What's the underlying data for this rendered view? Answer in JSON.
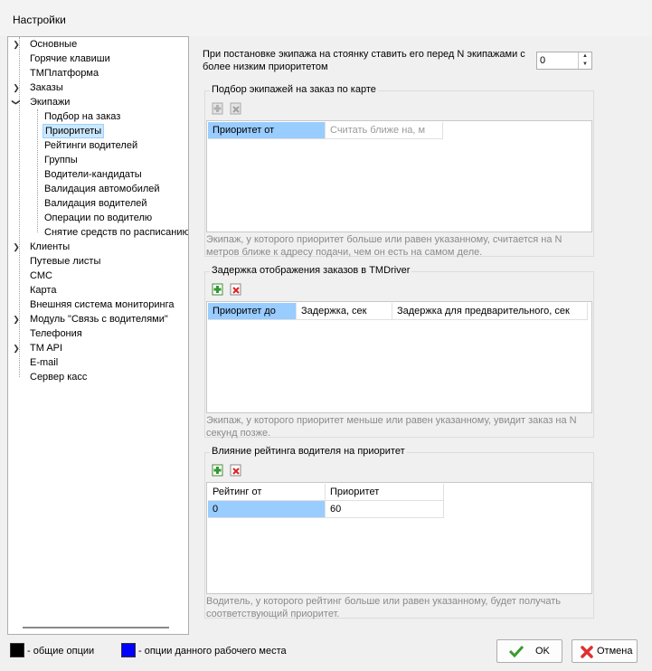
{
  "window": {
    "title": "Настройки"
  },
  "tree": {
    "items": [
      {
        "label": "Основные",
        "level": 0,
        "expandable": true
      },
      {
        "label": "Горячие клавиши",
        "level": 0,
        "expandable": false
      },
      {
        "label": "ТМПлатформа",
        "level": 0,
        "expandable": false
      },
      {
        "label": "Заказы",
        "level": 0,
        "expandable": true
      },
      {
        "label": "Экипажи",
        "level": 0,
        "expandable": true,
        "expanded": true
      },
      {
        "label": "Подбор на заказ",
        "level": 1
      },
      {
        "label": "Приоритеты",
        "level": 1,
        "selected": true
      },
      {
        "label": "Рейтинги водителей",
        "level": 1
      },
      {
        "label": "Группы",
        "level": 1
      },
      {
        "label": "Водители-кандидаты",
        "level": 1
      },
      {
        "label": "Валидация автомобилей",
        "level": 1
      },
      {
        "label": "Валидация водителей",
        "level": 1
      },
      {
        "label": "Операции по водителю",
        "level": 1
      },
      {
        "label": "Снятие средств по расписанию",
        "level": 1
      },
      {
        "label": "Клиенты",
        "level": 0,
        "expandable": true
      },
      {
        "label": "Путевые листы",
        "level": 0,
        "expandable": false
      },
      {
        "label": "СМС",
        "level": 0,
        "expandable": false
      },
      {
        "label": "Карта",
        "level": 0,
        "expandable": false
      },
      {
        "label": "Внешняя система мониторинга",
        "level": 0,
        "expandable": false
      },
      {
        "label": "Модуль \"Связь с водителями\"",
        "level": 0,
        "expandable": true
      },
      {
        "label": "Телефония",
        "level": 0,
        "expandable": false
      },
      {
        "label": "TM API",
        "level": 0,
        "expandable": true
      },
      {
        "label": "E-mail",
        "level": 0,
        "expandable": false
      },
      {
        "label": "Сервер касс",
        "level": 0,
        "expandable": false
      }
    ]
  },
  "main": {
    "top_setting": {
      "label": "При постановке экипажа на стоянку ставить его перед N экипажами с более низким приоритетом",
      "value": "0"
    },
    "group1": {
      "title": "Подбор экипажей на заказ по карте",
      "columns": [
        "Приоритет от",
        "Считать ближе на, м"
      ],
      "note": "Экипаж, у которого приоритет больше или равен указанному, считается на N метров ближе к адресу подачи, чем он есть на самом деле."
    },
    "group2": {
      "title": "Задержка отображения заказов в TMDriver",
      "columns": [
        "Приоритет до",
        "Задержка, сек",
        "Задержка для предварительного, сек"
      ],
      "note": "Экипаж, у которого приоритет меньше или равен указанному, увидит заказ на N секунд позже."
    },
    "group3": {
      "title": "Влияние рейтинга водителя на приоритет",
      "columns": [
        "Рейтинг от",
        "Приоритет"
      ],
      "rows": [
        [
          "0",
          "60"
        ]
      ],
      "note": "Водитель, у которого рейтинг больше или равен указанному, будет получать соответствующий приоритет."
    }
  },
  "footer": {
    "legend_general": "- общие опции",
    "legend_workplace": "- опции данного рабочего места",
    "legend_general_color": "#000000",
    "legend_workplace_color": "#0000ff",
    "ok_label": "OK",
    "cancel_label": "Отмена"
  }
}
